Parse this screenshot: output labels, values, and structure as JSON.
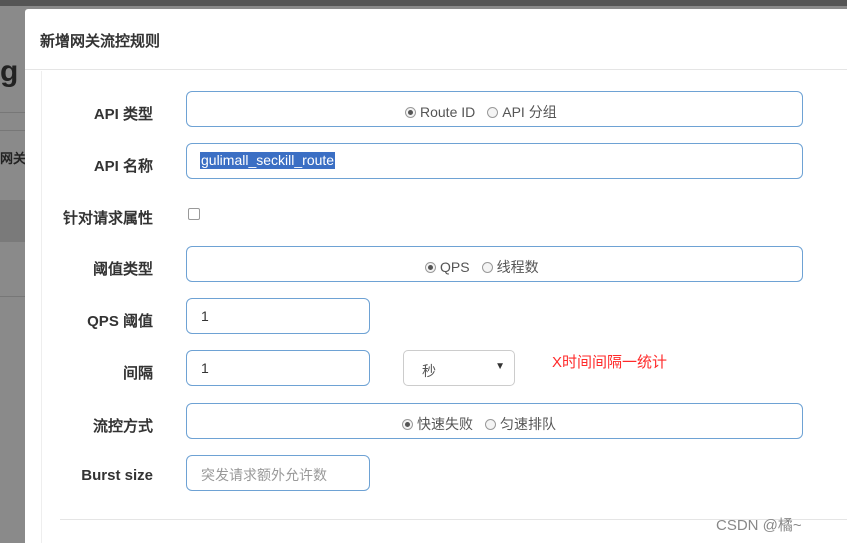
{
  "background": {
    "partial_letter": "g",
    "partial_nav": "网关"
  },
  "modal": {
    "title": "新增网关流控规则",
    "fields": {
      "api_type": {
        "label": "API 类型",
        "options": [
          "Route ID",
          "API 分组"
        ],
        "selected": "Route ID"
      },
      "api_name": {
        "label": "API 名称",
        "value": "gulimall_seckill_route"
      },
      "request_attr": {
        "label": "针对请求属性",
        "checked": false
      },
      "threshold_type": {
        "label": "阈值类型",
        "options": [
          "QPS",
          "线程数"
        ],
        "selected": "QPS"
      },
      "qps_threshold": {
        "label": "QPS 阈值",
        "value": "1"
      },
      "interval": {
        "label": "间隔",
        "value": "1",
        "unit": "秒"
      },
      "control_mode": {
        "label": "流控方式",
        "options": [
          "快速失败",
          "匀速排队"
        ],
        "selected": "快速失败"
      },
      "burst_size": {
        "label": "Burst size",
        "placeholder": "突发请求额外允许数"
      }
    }
  },
  "annotation": {
    "text": "X时间间隔一统计",
    "color": "#ff2a2a"
  },
  "watermark": "CSDN @橘~"
}
